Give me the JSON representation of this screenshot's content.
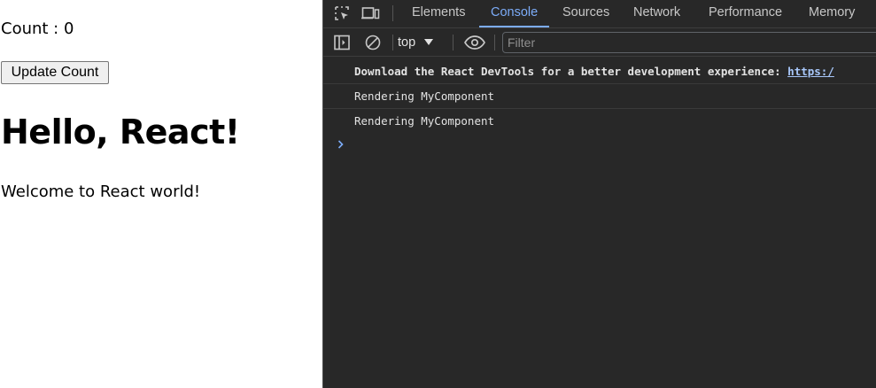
{
  "page": {
    "count_label": "Count : 0",
    "update_button": "Update Count",
    "heading": "Hello, React!",
    "welcome": "Welcome to React world!"
  },
  "devtools": {
    "tabs": [
      {
        "label": "Elements",
        "active": false
      },
      {
        "label": "Console",
        "active": true
      },
      {
        "label": "Sources",
        "active": false
      },
      {
        "label": "Network",
        "active": false
      },
      {
        "label": "Performance",
        "active": false
      },
      {
        "label": "Memory",
        "active": false
      }
    ],
    "toolbar": {
      "context": "top",
      "filter_placeholder": "Filter"
    },
    "console": {
      "messages": [
        {
          "text": "Download the React DevTools for a better development experience: ",
          "link": "https:/"
        },
        {
          "text": "Rendering MyComponent"
        },
        {
          "text": "Rendering MyComponent"
        }
      ]
    },
    "colors": {
      "background": "#282828",
      "accent": "#7cacf8",
      "link": "#a8c7fa",
      "text": "#e3e3e3"
    },
    "icons": [
      "inspect-element-icon",
      "device-toolbar-icon",
      "sidebar-toggle-icon",
      "clear-console-icon",
      "dropdown-triangle-icon",
      "eye-icon",
      "prompt-chevron-icon"
    ]
  }
}
